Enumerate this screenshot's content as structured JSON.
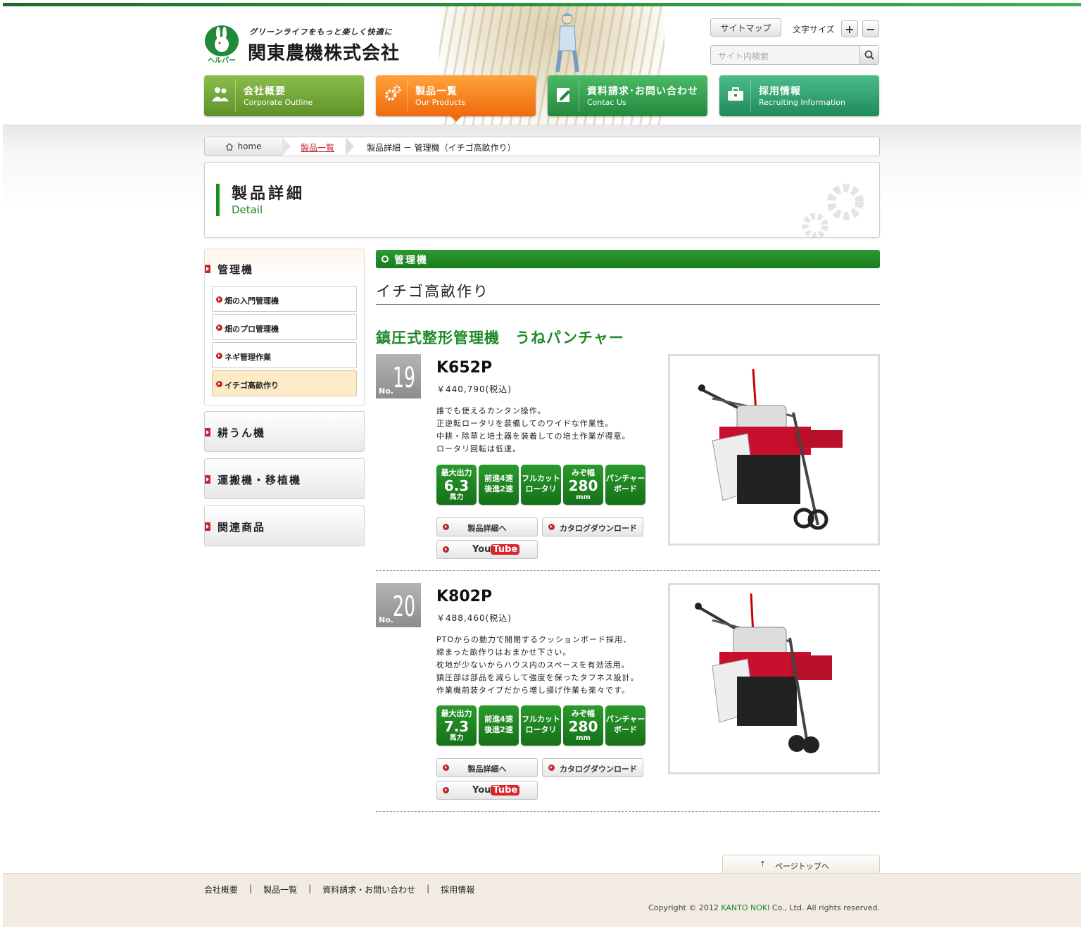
{
  "header": {
    "tagline": "グリーンライフをもっと楽しく快適に",
    "company": "関東農機株式会社",
    "logo_text": "ヘルパー",
    "sitemap": "サイトマップ",
    "font_size_label": "文字サイズ",
    "font_plus": "+",
    "font_minus": "−",
    "search_placeholder": "サイト内検索"
  },
  "nav": [
    {
      "jp": "会社概要",
      "en": "Corporate Outline",
      "icon": "people-icon",
      "color": "#6f9f33"
    },
    {
      "jp": "製品一覧",
      "en": "Our Products",
      "icon": "gear-icon",
      "color": "#f57a14"
    },
    {
      "jp": "資料請求･お問い合わせ",
      "en": "Contac Us",
      "icon": "pencil-icon",
      "color": "#2a9845"
    },
    {
      "jp": "採用情報",
      "en": "Recruiting Information",
      "icon": "briefcase-icon",
      "color": "#27966a"
    }
  ],
  "breadcrumb": {
    "home": "home",
    "level2": "製品一覧",
    "current": "製品詳細 － 管理機（イチゴ高畝作り）"
  },
  "page_title": {
    "jp": "製品詳細",
    "en": "Detail"
  },
  "sidebar": {
    "section1": "管理機",
    "items": [
      "畑の入門管理機",
      "畑のプロ管理機",
      "ネギ管理作業",
      "イチゴ高畝作り"
    ],
    "active_item": "イチゴ高畝作り",
    "sections": [
      "耕うん機",
      "運搬機・移植機",
      "関連商品"
    ]
  },
  "main": {
    "category": "管理機",
    "subtitle": "イチゴ高畝作り",
    "series_title": "鎮圧式整形管理機　うねパンチャー",
    "detail_button": "製品詳細へ",
    "catalog_button": "カタログダウンロード",
    "youtube_you": "You",
    "youtube_tube": "Tube",
    "products": [
      {
        "no_label": "No.",
        "no": "19",
        "model": "K652P",
        "price": "￥440,790(税込)",
        "desc": [
          "誰でも使えるカンタン操作。",
          "正逆転ロータリを装備してのワイドな作業性。",
          "中耕・除草と培土器を装着しての培土作業が得意。",
          "ロータリ回転は低速。"
        ],
        "features": {
          "power_top": "最大出力",
          "power": "6.3",
          "power_unit": "馬力",
          "gear1": "前進4速",
          "gear2": "後進2速",
          "rot1": "フルカット",
          "rot2": "ロータリ",
          "width_top": "みぞ幅",
          "width": "280",
          "width_unit": "mm",
          "board1": "パンチャー",
          "board2": "ボード"
        }
      },
      {
        "no_label": "No.",
        "no": "20",
        "model": "K802P",
        "price": "￥488,460(税込)",
        "desc": [
          "PTOからの動力で開閉するクッションボード採用、",
          "締まった畝作りはおまかせ下さい。",
          "枕地が少ないからハウス内のスペースを有効活用。",
          "鎮圧部は部品を減らして強度を保ったタフネス設計。",
          "作業機前装タイプだから増し揚げ作業も楽々です。"
        ],
        "features": {
          "power_top": "最大出力",
          "power": "7.3",
          "power_unit": "馬力",
          "gear1": "前進4速",
          "gear2": "後進2速",
          "rot1": "フルカット",
          "rot2": "ロータリ",
          "width_top": "みぞ幅",
          "width": "280",
          "width_unit": "mm",
          "board1": "パンチャー",
          "board2": "ボード"
        }
      }
    ]
  },
  "footer": {
    "page_top": "ページトップへ",
    "links": [
      "会社概要",
      "製品一覧",
      "資料請求・お問い合わせ",
      "採用情報"
    ],
    "separator": "|",
    "copyright_pre": "Copyright © 2012 ",
    "copyright_company": "KANTO NOKI",
    "copyright_post": " Co., Ltd. All rights reserved."
  }
}
